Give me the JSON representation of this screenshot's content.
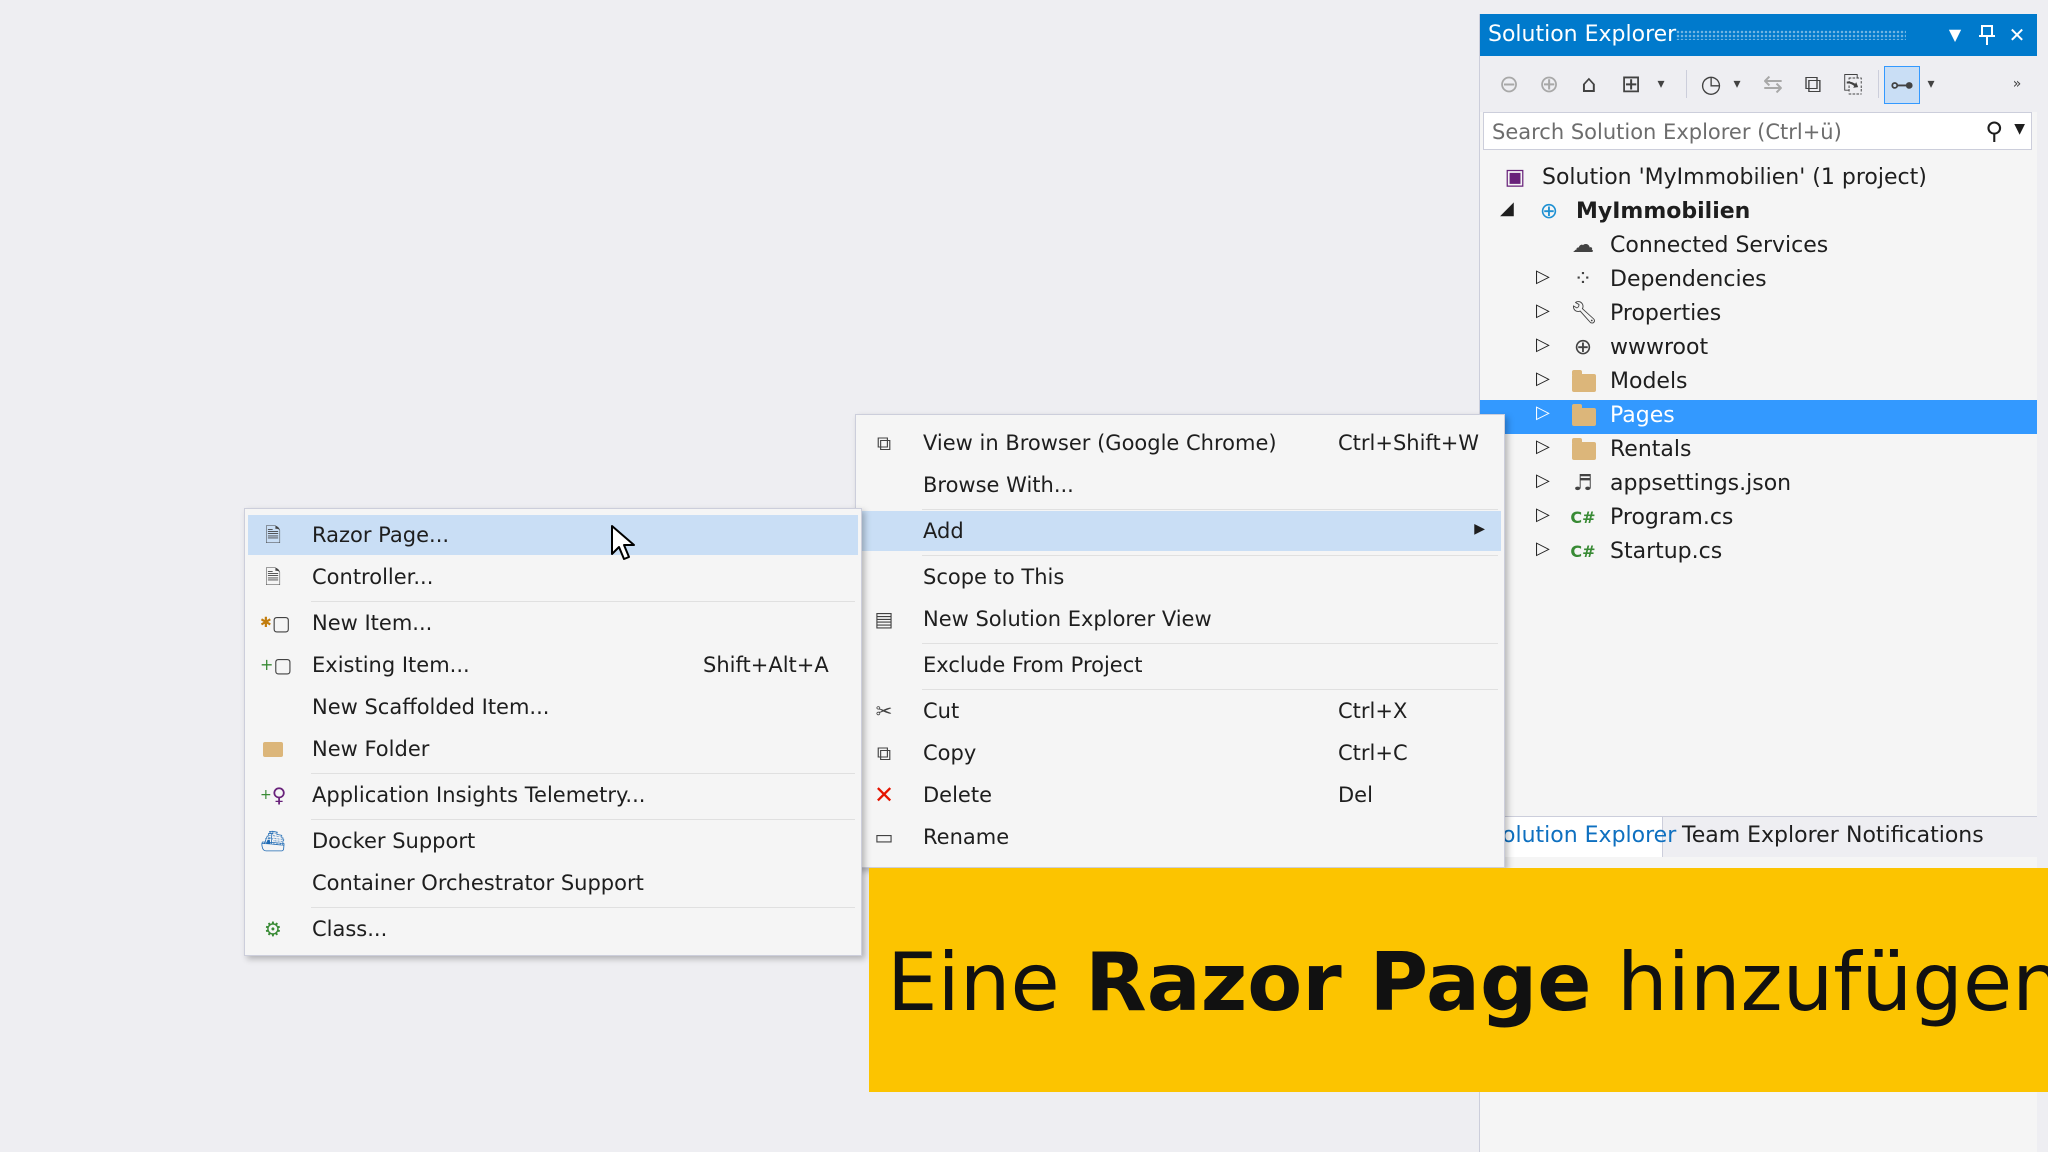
{
  "solution_explorer": {
    "title": "Solution Explorer",
    "search_placeholder": "Search Solution Explorer (Ctrl+ü)",
    "tree": [
      {
        "label": "Solution 'MyImmobilien' (1 project)",
        "icon": "solution-icon",
        "level": 0
      },
      {
        "label": "MyImmobilien",
        "icon": "web-project-icon",
        "level": 1,
        "bold": true,
        "expanded": true
      },
      {
        "label": "Connected Services",
        "icon": "connected-services-icon",
        "level": 2
      },
      {
        "label": "Dependencies",
        "icon": "dependencies-icon",
        "level": 2
      },
      {
        "label": "Properties",
        "icon": "wrench-icon",
        "level": 2
      },
      {
        "label": "wwwroot",
        "icon": "globe-icon",
        "level": 2
      },
      {
        "label": "Models",
        "icon": "folder-icon",
        "level": 2
      },
      {
        "label": "Pages",
        "icon": "folder-icon",
        "level": 2,
        "selected": true
      },
      {
        "label": "Rentals",
        "icon": "folder-icon",
        "level": 2
      },
      {
        "label": "appsettings.json",
        "icon": "json-file-icon",
        "level": 2
      },
      {
        "label": "Program.cs",
        "icon": "csharp-file-icon",
        "level": 2
      },
      {
        "label": "Startup.cs",
        "icon": "csharp-file-icon",
        "level": 2
      }
    ],
    "tabs": [
      "olution Explorer",
      "Team Explorer",
      "Notifications"
    ],
    "active_tab_index": 0
  },
  "context_menu": {
    "items": [
      {
        "label": "View in Browser (Google Chrome)",
        "shortcut": "Ctrl+Shift+W",
        "icon": "browser-view-icon"
      },
      {
        "label": "Browse With...",
        "shortcut": ""
      },
      {
        "label": "Add",
        "submenu": true,
        "highlighted": true
      },
      {
        "label": "Scope to This",
        "shortcut": ""
      },
      {
        "label": "New Solution Explorer View",
        "icon": "new-view-icon"
      },
      {
        "label": "Exclude From Project",
        "shortcut": ""
      },
      {
        "label": "Cut",
        "shortcut": "Ctrl+X",
        "icon": "scissors-icon"
      },
      {
        "label": "Copy",
        "shortcut": "Ctrl+C",
        "icon": "copy-icon"
      },
      {
        "label": "Delete",
        "shortcut": "Del",
        "icon": "delete-icon"
      },
      {
        "label": "Rename",
        "shortcut": "",
        "icon": "rename-icon"
      }
    ]
  },
  "add_submenu": {
    "items": [
      {
        "label": "Razor Page...",
        "icon": "razor-page-icon",
        "highlighted": true
      },
      {
        "label": "Controller...",
        "icon": "controller-icon"
      },
      {
        "label": "New Item...",
        "icon": "new-item-icon"
      },
      {
        "label": "Existing Item...",
        "shortcut": "Shift+Alt+A",
        "icon": "existing-item-icon"
      },
      {
        "label": "New Scaffolded Item..."
      },
      {
        "label": "New Folder",
        "icon": "new-folder-icon"
      },
      {
        "label": "Application Insights Telemetry...",
        "icon": "insights-icon"
      },
      {
        "label": "Docker Support",
        "icon": "docker-icon"
      },
      {
        "label": "Container Orchestrator Support"
      },
      {
        "label": "Class...",
        "icon": "class-icon"
      }
    ]
  },
  "banner": {
    "prefix": "Eine ",
    "bold": "Razor Page",
    "suffix": " hinzufügen",
    "background": "#fcc400"
  },
  "colors": {
    "accent": "#007acc",
    "selection": "#3399ff",
    "menu_highlight": "#c9def5",
    "delete_red": "#e51400"
  }
}
